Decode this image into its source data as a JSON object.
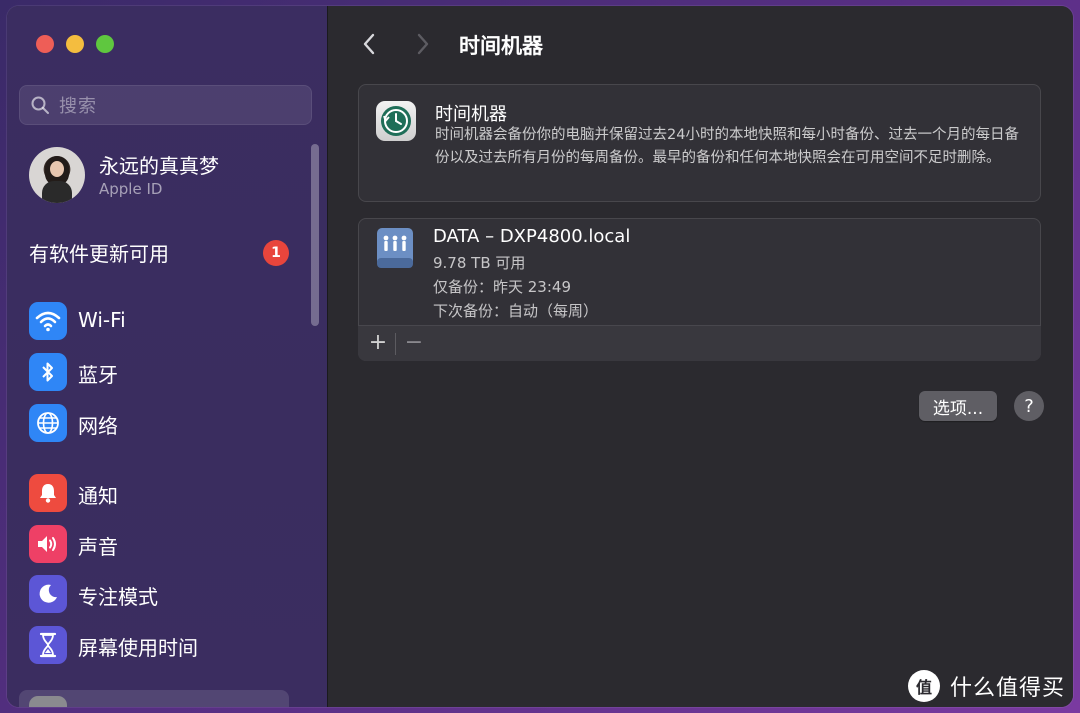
{
  "sidebar": {
    "search_placeholder": "搜索",
    "profile": {
      "name": "永远的真真梦",
      "subtitle": "Apple ID"
    },
    "update": {
      "label": "有软件更新可用",
      "badge": "1"
    },
    "items": [
      {
        "label": "Wi-Fi",
        "icon": "wifi-icon"
      },
      {
        "label": "蓝牙",
        "icon": "bluetooth-icon"
      },
      {
        "label": "网络",
        "icon": "globe-icon"
      },
      {
        "label": "通知",
        "icon": "bell-icon"
      },
      {
        "label": "声音",
        "icon": "speaker-icon"
      },
      {
        "label": "专注模式",
        "icon": "moon-icon"
      },
      {
        "label": "屏幕使用时间",
        "icon": "hourglass-icon"
      }
    ]
  },
  "main": {
    "title": "时间机器",
    "time_machine": {
      "title": "时间机器",
      "description": "时间机器会备份你的电脑并保留过去24小时的本地快照和每小时备份、过去一个月的每日备份以及过去所有月份的每周备份。最早的备份和任何本地快照会在可用空间不足时删除。"
    },
    "disk": {
      "name": "DATA – DXP4800.local",
      "capacity": "9.78 TB 可用",
      "last_backup": "仅备份：昨天 23:49",
      "next_backup": "下次备份：自动（每周）"
    },
    "toolbar": {
      "add": "+",
      "remove": "−"
    },
    "options_button": "选项...",
    "help_button": "?"
  },
  "watermark": {
    "logo": "值",
    "text": "什么值得买"
  },
  "colors": {
    "sidebar_bg": "#3b2d61",
    "main_bg": "#2b2a2f",
    "card_bg": "#323137",
    "accent_blue": "#2f86f6",
    "badge_red": "#e8453c"
  }
}
